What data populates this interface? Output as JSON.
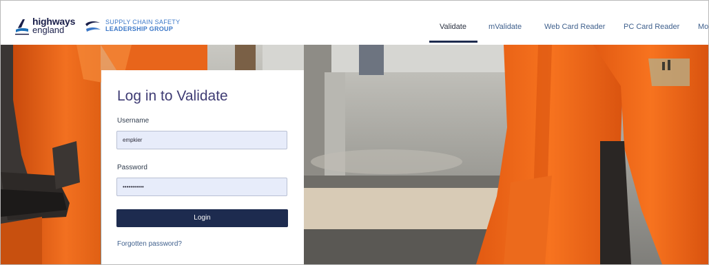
{
  "header": {
    "logo_highways": {
      "line1": "highways",
      "line2": "england"
    },
    "logo_supply_chain": {
      "line1": "SUPPLY CHAIN SAFETY",
      "line2": "LEADERSHIP GROUP"
    },
    "nav": [
      {
        "label": "Validate",
        "active": true
      },
      {
        "label": "mValidate",
        "active": false
      },
      {
        "label": "Web Card Reader",
        "active": false
      },
      {
        "label": "PC Card Reader",
        "active": false
      },
      {
        "label": "Mo",
        "active": false
      }
    ]
  },
  "login": {
    "title": "Log in to Validate",
    "username_label": "Username",
    "username_value": "empkier",
    "password_label": "Password",
    "password_value": "•••••••••••",
    "login_button": "Login",
    "forgot_link": "Forgotten password?"
  },
  "colors": {
    "brand_navy": "#1d2b4f",
    "title_purple": "#3f3c74",
    "link_blue": "#3e5f8c",
    "input_bg": "#e7ecfa",
    "hivis_orange": "#f26d1f"
  }
}
